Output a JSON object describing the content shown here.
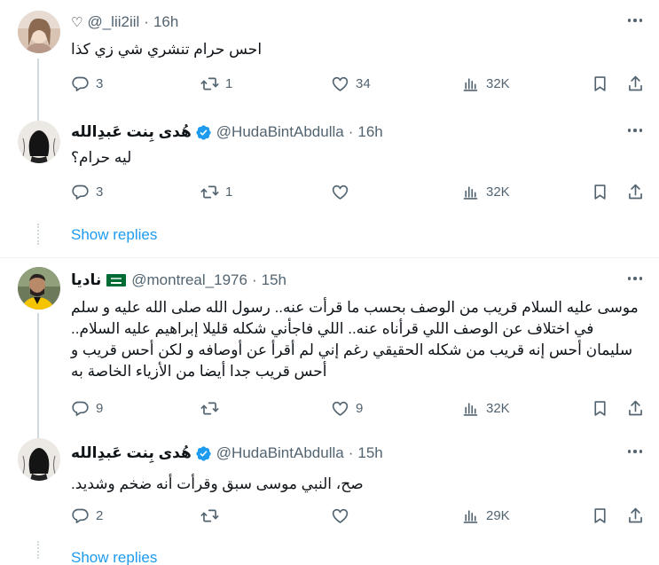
{
  "tweets": [
    {
      "name": "",
      "prefix_icon": "heart-outline-icon",
      "handle": "@_lii2iil",
      "time": "16h",
      "text": "احس حرام تنشري شي زي كذا",
      "replies": "3",
      "reposts": "1",
      "likes": "34",
      "views": "32K"
    },
    {
      "name": "هُدى بِنت عَبدِالله",
      "verified": true,
      "handle": "@HudaBintAbdulla",
      "time": "16h",
      "text": "ليه حرام؟",
      "replies": "3",
      "reposts": "1",
      "likes": "",
      "views": "32K"
    },
    {
      "name": "ناديا",
      "flag": "saudi-flag-icon",
      "handle": "@montreal_1976",
      "time": "15h",
      "text": "موسى عليه السلام قريب من الوصف بحسب ما قرأت عنه.. رسول الله صلى الله عليه و سلم في اختلاف عن الوصف اللي قرأناه عنه.. اللي فاجأني شكله قليلا إبراهيم عليه السلام.. سليمان أحس إنه قريب من شكله الحقيقي رغم إني لم أقرأ عن أوصافه و لكن أحس قريب و أحس قريب جدا أيضا من الأزياء الخاصة به",
      "replies": "9",
      "reposts": "",
      "likes": "9",
      "views": "32K"
    },
    {
      "name": "هُدى بِنت عَبدِالله",
      "verified": true,
      "handle": "@HudaBintAbdulla",
      "time": "15h",
      "text": "صح، النبي موسى سبق وقرأت أنه ضخم وشديد.",
      "replies": "2",
      "reposts": "",
      "likes": "",
      "views": "29K"
    }
  ],
  "show_replies_label": "Show replies",
  "separator": "·",
  "colors": {
    "link": "#1d9bf0",
    "muted": "#536471",
    "verified": "#1d9bf0",
    "thread_line": "#cfd9de"
  }
}
